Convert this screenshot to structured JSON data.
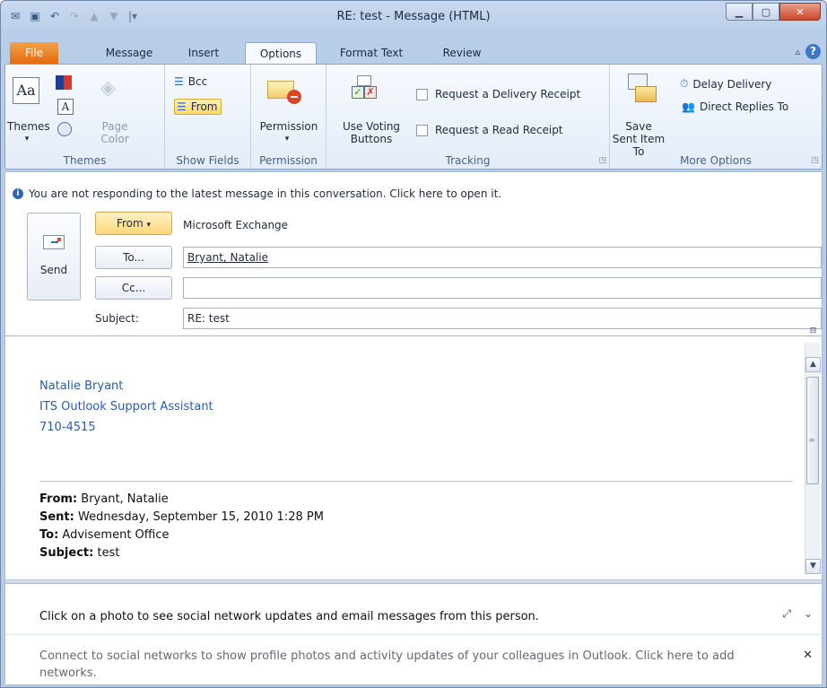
{
  "window": {
    "title": "RE: test  -  Message (HTML)",
    "controls": [
      "minimize",
      "maximize",
      "close"
    ]
  },
  "quick_access": {
    "icons": [
      "outlook-icon",
      "save-icon",
      "undo-icon",
      "redo-icon",
      "previous-icon",
      "next-icon",
      "customize-icon"
    ]
  },
  "tabs": [
    "File",
    "Message",
    "Insert",
    "Options",
    "Format Text",
    "Review"
  ],
  "active_tab": "Options",
  "ribbon": {
    "themes": {
      "themes_label": "Themes",
      "page_color_label": "Page Color",
      "group_label": "Themes"
    },
    "show_fields": {
      "bcc": "Bcc",
      "from": "From",
      "group_label": "Show Fields"
    },
    "permission": {
      "label": "Permission",
      "group_label": "Permission"
    },
    "tracking": {
      "voting_label": "Use Voting Buttons",
      "delivery_receipt": "Request a Delivery Receipt",
      "read_receipt": "Request a Read Receipt",
      "group_label": "Tracking"
    },
    "more_options": {
      "save_sent_label": "Save Sent Item To",
      "delay_delivery": "Delay Delivery",
      "direct_replies": "Direct Replies To",
      "group_label": "More Options"
    }
  },
  "compose": {
    "info_bar": "You are not responding to the latest message in this conversation. Click here to open it.",
    "send_label": "Send",
    "from_button": "From",
    "from_value": "Microsoft Exchange",
    "to_button": "To...",
    "to_value": "Bryant, Natalie",
    "cc_button": "Cc...",
    "cc_value": "",
    "subject_label": "Subject:",
    "subject_value": "RE: test"
  },
  "body": {
    "signature": [
      "Natalie Bryant",
      "ITS Outlook Support Assistant",
      "710-4515"
    ],
    "header": {
      "from_label": "From:",
      "from": "Bryant, Natalie",
      "sent_label": "Sent:",
      "sent": "Wednesday, September 15, 2010 1:28 PM",
      "to_label": "To:",
      "to": "Advisement Office",
      "subject_label": "Subject:",
      "subject": "test"
    }
  },
  "social": {
    "line1": "Click on a photo to see social network updates and email messages from this person.",
    "line2": "Connect to social networks to show profile photos and activity updates of your colleagues in Outlook. Click here to add networks."
  },
  "colors": {
    "accent_file_tab": "#e06c12",
    "signature_blue": "#2b5ca8",
    "from_highlight": "#ffd868"
  }
}
